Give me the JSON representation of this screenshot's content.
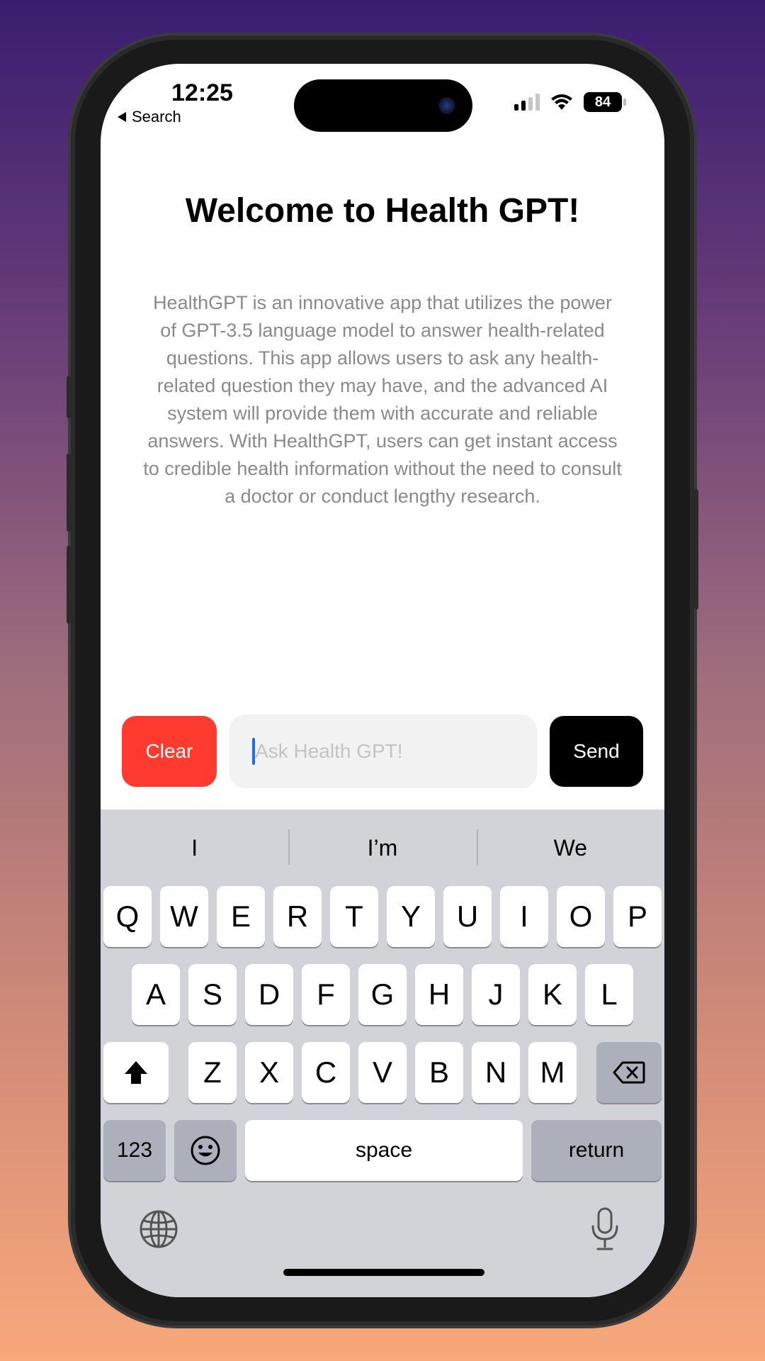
{
  "status_bar": {
    "time": "12:25",
    "back_label": "Search",
    "battery": "84"
  },
  "main": {
    "title": "Welcome to Health GPT!",
    "description": "HealthGPT is an innovative app that utilizes the power of GPT-3.5 language model to answer health-related questions. This app allows users to ask any health-related question they may have, and the advanced AI system will provide them with accurate and reliable answers. With HealthGPT, users can get instant access to credible health information without the need to consult a doctor or conduct lengthy research."
  },
  "input_bar": {
    "clear_label": "Clear",
    "placeholder": "Ask Health GPT!",
    "send_label": "Send"
  },
  "colors": {
    "clear": "#ff3b30",
    "send": "#000000",
    "cursor": "#1e6cf0"
  },
  "keyboard": {
    "suggestions": [
      "I",
      "I’m",
      "We"
    ],
    "row1": [
      "Q",
      "W",
      "E",
      "R",
      "T",
      "Y",
      "U",
      "I",
      "O",
      "P"
    ],
    "row2": [
      "A",
      "S",
      "D",
      "F",
      "G",
      "H",
      "J",
      "K",
      "L"
    ],
    "row3": [
      "Z",
      "X",
      "C",
      "V",
      "B",
      "N",
      "M"
    ],
    "numbers_label": "123",
    "space_label": "space",
    "return_label": "return",
    "icons": [
      "shift-icon",
      "backspace-icon",
      "emoji-icon",
      "globe-icon",
      "microphone-icon"
    ]
  }
}
